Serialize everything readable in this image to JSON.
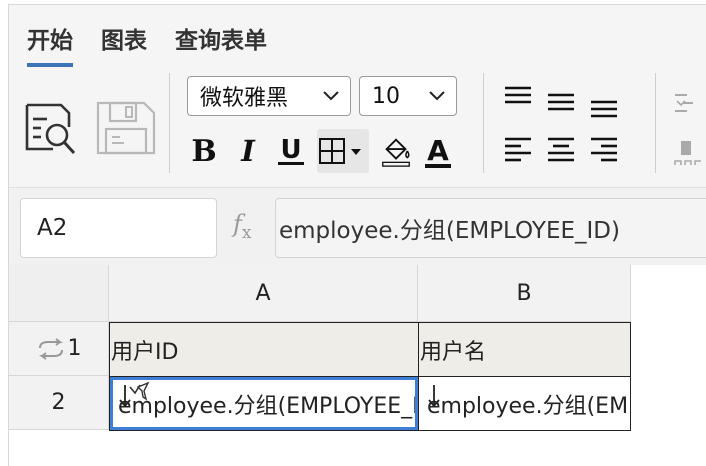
{
  "tabs": [
    {
      "label": "开始",
      "active": true
    },
    {
      "label": "图表",
      "active": false
    },
    {
      "label": "查询表单",
      "active": false
    }
  ],
  "toolbar": {
    "font_family": "微软雅黑",
    "font_size": "10",
    "bold": "B",
    "italic": "I",
    "underline": "U",
    "font_color": "A"
  },
  "formula_bar": {
    "cell_ref": "A2",
    "fx_label": "f",
    "fx_sub": "x",
    "formula": "employee.分组(EMPLOYEE_ID)"
  },
  "grid": {
    "columns": [
      "A",
      "B"
    ],
    "rows": [
      {
        "header": "1",
        "cells": [
          "用户ID",
          "用户名"
        ]
      },
      {
        "header": "2",
        "cells": [
          "employee.分组(EMPLOYEE_ID)",
          "employee.分组(EMPLOYEE_NAME)"
        ]
      }
    ],
    "selected_cell": "A2"
  },
  "colors": {
    "accent": "#3d74b8",
    "selection": "#3d7fd6",
    "header_row_fill": "#efede7"
  }
}
